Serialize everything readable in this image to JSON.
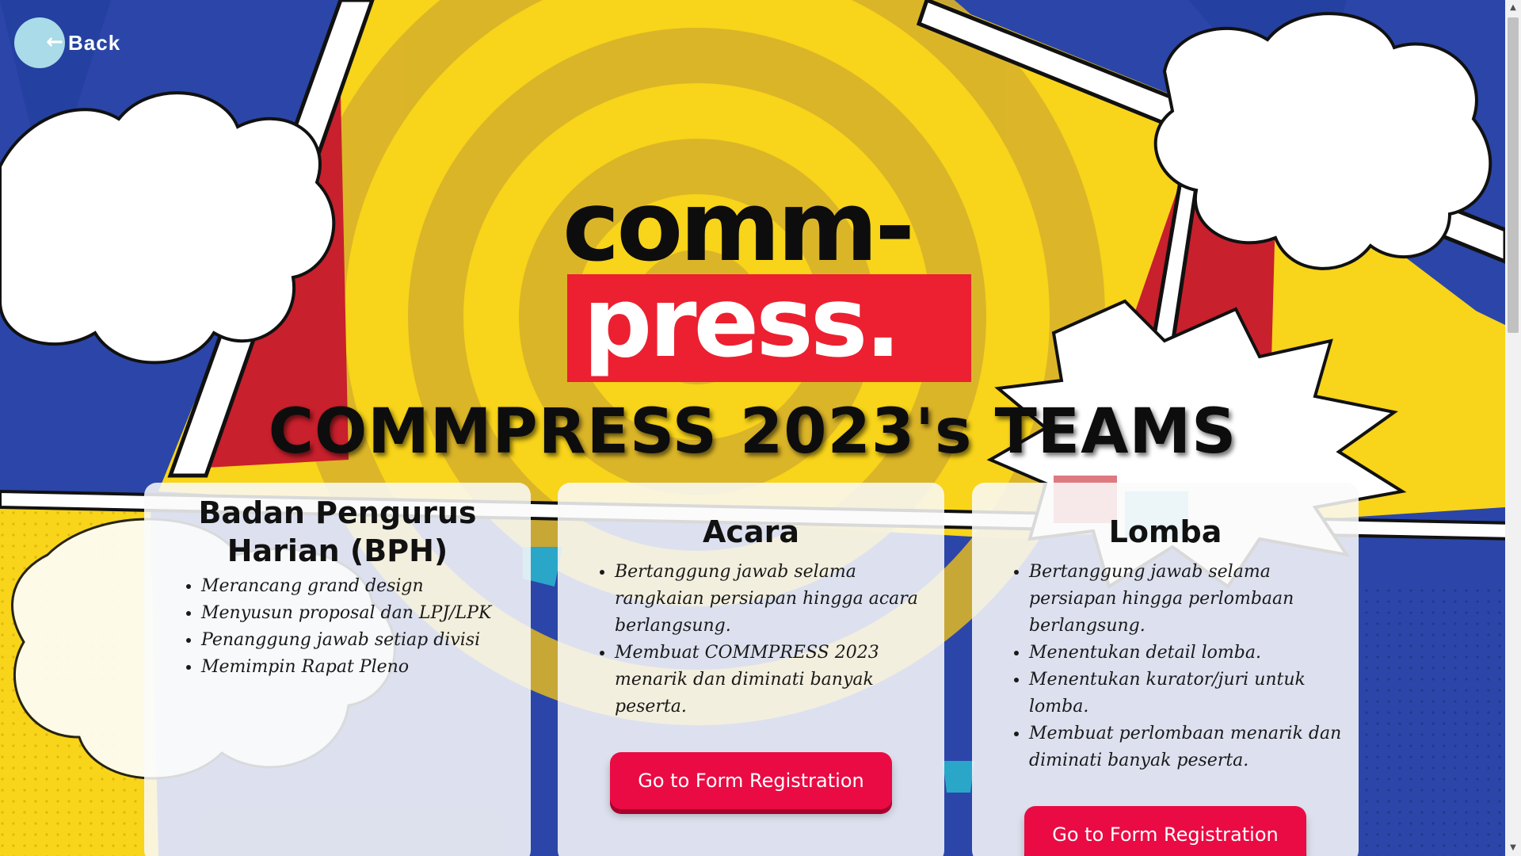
{
  "nav": {
    "back_label": "Back",
    "back_arrow": "←"
  },
  "logo": {
    "line1": "comm-",
    "line2": "press."
  },
  "page_title": "COMMPRESS 2023's TEAMS",
  "cards": [
    {
      "title": "Badan Pengurus Harian (BPH)",
      "duties": [
        "Merancang grand design",
        "Menyusun proposal dan LPJ/LPK",
        "Penanggung jawab setiap divisi",
        "Memimpin Rapat Pleno"
      ]
    },
    {
      "title": "Acara",
      "duties": [
        "Bertanggung jawab selama rangkaian persiapan hingga acara berlangsung.",
        "Membuat COMMPRESS 2023 menarik dan diminati banyak peserta."
      ],
      "button_label": "Go to Form Registration"
    },
    {
      "title": "Lomba",
      "duties": [
        "Bertanggung jawab selama persiapan hingga perlombaan berlangsung.",
        "Menentukan detail lomba.",
        "Menentukan kurator/juri untuk lomba.",
        "Membuat perlombaan menarik dan diminati banyak peserta."
      ],
      "button_label": "Go to Form Registration"
    }
  ],
  "colors": {
    "blue": "#2b46a8",
    "yellow": "#f8d41a",
    "red": "#c8202c",
    "brand_red": "#ec2030",
    "button": "#ea0b44",
    "back_circle": "#a9dbe8"
  },
  "icons": {
    "back": "arrow-left-icon",
    "scroll_up": "caret-up-icon",
    "scroll_down": "caret-down-icon"
  }
}
